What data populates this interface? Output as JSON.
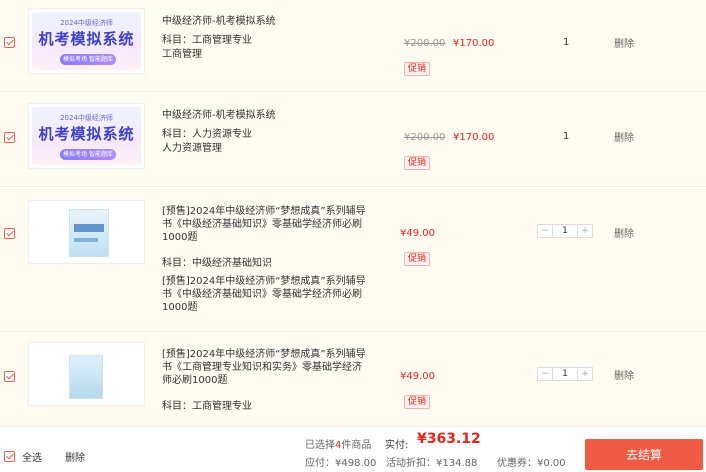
{
  "items": [
    {
      "title": "中级经济师-机考模拟系统",
      "subject_line": "科目：工商管理专业",
      "desc": "工商管理",
      "old_price": "¥200.00",
      "price": "¥170.00",
      "promo": "促销",
      "qty": "1",
      "delete": "删除",
      "banner": {
        "year": "2024中级经济师",
        "name": "机考模拟系统",
        "tag": "模拟考场 智能题库"
      }
    },
    {
      "title": "中级经济师-机考模拟系统",
      "subject_line": "科目：人力资源专业",
      "desc": "人力资源管理",
      "old_price": "¥200.00",
      "price": "¥170.00",
      "promo": "促销",
      "qty": "1",
      "delete": "删除",
      "banner": {
        "year": "2024中级经济师",
        "name": "机考模拟系统",
        "tag": "模拟考场 智能题库"
      }
    },
    {
      "title": "[预售]2024年中级经济师“梦想成真”系列辅导书《中级经济基础知识》零基础学经济师必刷1000题",
      "subject_line": "科目：中级经济基础知识",
      "desc": "[预售]2024年中级经济师“梦想成真”系列辅导书《中级经济基础知识》零基础学经济师必刷1000题",
      "price": "¥49.00",
      "promo": "促销",
      "qty": "1",
      "minus": "−",
      "plus": "+",
      "delete": "删除"
    },
    {
      "title": "[预售]2024年中级经济师“梦想成真”系列辅导书《工商管理专业知识和实务》零基础学经济师必刷1000题",
      "subject_line": "科目：工商管理专业",
      "price": "¥49.00",
      "promo": "促销",
      "qty": "1",
      "minus": "−",
      "plus": "+",
      "delete": "删除"
    }
  ],
  "footer": {
    "select_all": "全选",
    "delete": "删除",
    "selected_prefix": "已选择",
    "selected_count": "4",
    "selected_suffix": "件商品",
    "actual_label": "实付:",
    "actual_value": "¥363.12",
    "payable": "应付：¥498.00",
    "discount": "活动折扣：¥134.88",
    "coupon": "优惠券：¥0.00",
    "checkout": "去结算"
  },
  "colors": {
    "accent": "#e1251b",
    "checkout_bg": "#ef5a45",
    "row_bg": "#fffbf0"
  }
}
